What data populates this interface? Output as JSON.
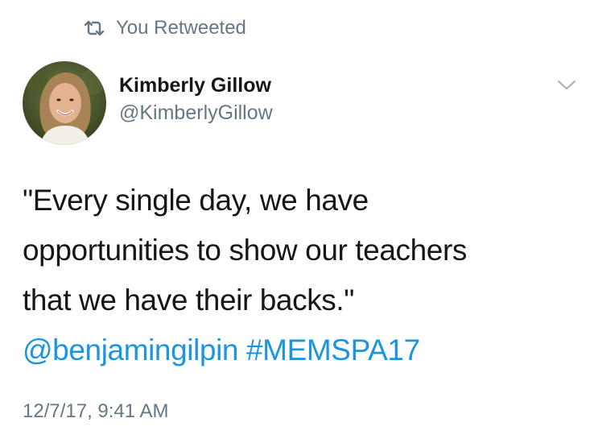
{
  "retweet": {
    "icon": "retweet-icon",
    "label": "You Retweeted"
  },
  "author": {
    "display_name": "Kimberly Gillow",
    "handle": "@KimberlyGillow",
    "avatar_icon": "avatar-photo"
  },
  "menu": {
    "icon": "chevron-down-icon"
  },
  "tweet": {
    "lines": [
      "\"Every single day, we have",
      "opportunities to show our teachers",
      "that we have their backs.\""
    ],
    "mention": "@benjamingilpin",
    "hashtag": "#MEMSPA17"
  },
  "timestamp": "12/7/17, 9:41 AM",
  "colors": {
    "text": "#14171a",
    "muted": "#657786",
    "link": "#1b95e0"
  }
}
